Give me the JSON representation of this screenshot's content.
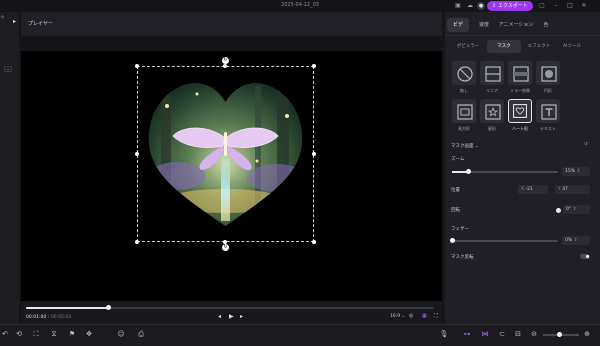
{
  "window": {
    "title": "2025-04-12_03"
  },
  "topbar": {
    "export_label": "エクスポート"
  },
  "player": {
    "title": "プレイヤー",
    "time_current": "00:01:00",
    "time_total": "/ 00:05:03",
    "ratio": "16:9",
    "progress": 0.2
  },
  "panel": {
    "tabs": [
      "ビデ",
      "速度",
      "アニメーション",
      "色"
    ],
    "subtabs": [
      "ポピュラー",
      "マスク",
      "エフェクト",
      "AIツール"
    ],
    "masks": [
      {
        "label": "無し",
        "icon": "none-icon"
      },
      {
        "label": "リニア",
        "icon": "linear-icon"
      },
      {
        "label": "ミラー効果",
        "icon": "mirror-icon"
      },
      {
        "label": "円形",
        "icon": "circle-icon"
      },
      {
        "label": "長方形",
        "icon": "rectangle-icon"
      },
      {
        "label": "星形",
        "icon": "star-icon"
      },
      {
        "label": "ハート形",
        "icon": "heart-icon"
      },
      {
        "label": "テキスト",
        "icon": "text-icon"
      }
    ],
    "active_mask": "ハート形",
    "section_title": "マスク画面",
    "zoom_label": "ズーム",
    "zoom_value": "15%",
    "position_label": "位置",
    "pos_x_label": "X",
    "pos_x_value": "-21",
    "pos_y_label": "Y",
    "pos_y_value": "47",
    "rotate_label": "回転",
    "rotate_value": "0°",
    "feather_label": "フェザー",
    "feather_value": "0%",
    "invert_label": "マスク反転"
  },
  "colors": {
    "accent": "#9b38f0",
    "bg": "#16161a",
    "panel": "#1f1f25"
  }
}
